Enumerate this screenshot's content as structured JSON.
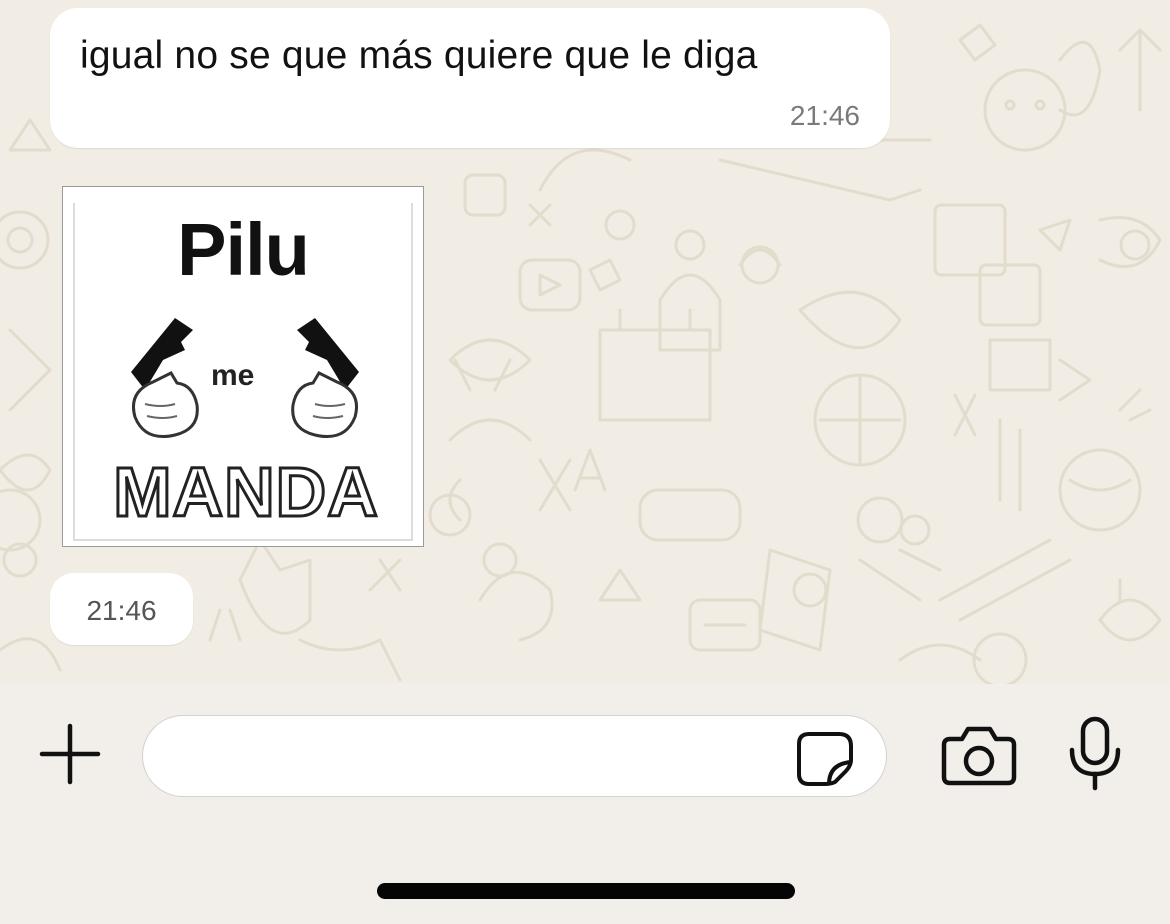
{
  "messages": [
    {
      "text": "igual no se que más quiere que le diga",
      "time": "21:46"
    },
    {
      "type": "sticker",
      "sticker_text": {
        "top": "Pilu",
        "middle": "me",
        "bottom": "MANDA"
      },
      "sticker_icons": [
        "pointing-gun-hand-left-icon",
        "pointing-gun-hand-right-icon"
      ],
      "time": "21:46"
    }
  ],
  "composer": {
    "value": "",
    "placeholder": "",
    "icons": {
      "add": "plus-icon",
      "sticker": "sticker-icon",
      "camera": "camera-icon",
      "mic": "microphone-icon"
    }
  },
  "colors": {
    "chat_background": "#f1ede4",
    "bubble_incoming": "#ffffff",
    "timestamp": "#7a7a7a",
    "icon": "#111111"
  }
}
